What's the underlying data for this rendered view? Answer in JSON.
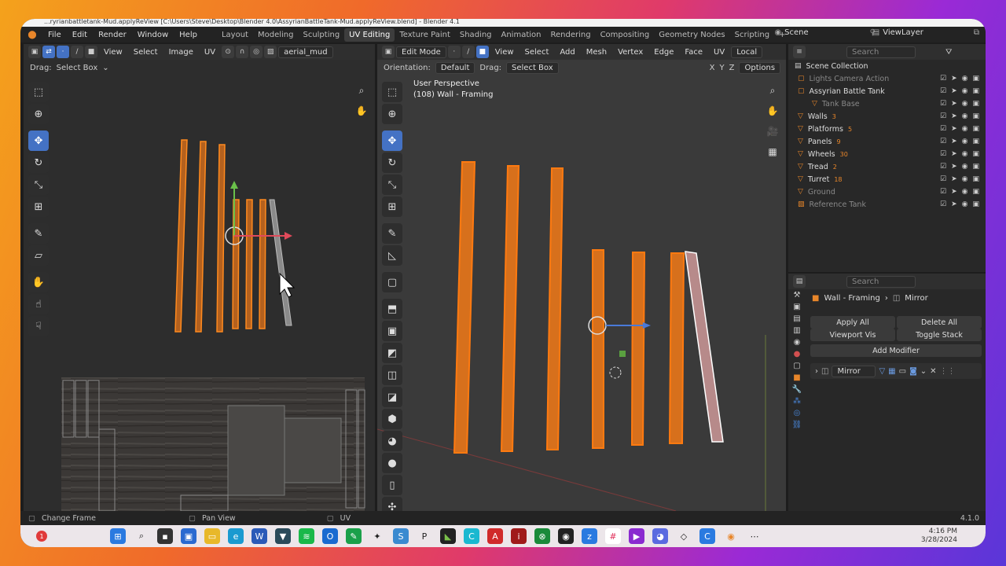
{
  "titlebar": {
    "text": "...ryrianbattletank-Mud.applyReView [C:\\Users\\Steve\\Desktop\\Blender 4.0\\AssyrianBattleTank-Mud.applyReView.blend] - Blender 4.1"
  },
  "menu": [
    "File",
    "Edit",
    "Render",
    "Window",
    "Help"
  ],
  "workspaces": [
    "Layout",
    "Modeling",
    "Sculpting",
    "UV Editing",
    "Texture Paint",
    "Shading",
    "Animation",
    "Rendering",
    "Compositing",
    "Geometry Nodes",
    "Scripting"
  ],
  "active_workspace": "UV Editing",
  "scene": {
    "label": "Scene",
    "view_layer": "ViewLayer"
  },
  "uv_editor": {
    "header": [
      "View",
      "Select",
      "Image",
      "UV"
    ],
    "image_name": "aerial_mud",
    "drag_label": "Drag:",
    "drag_value": "Select Box"
  },
  "viewport": {
    "mode": "Edit Mode",
    "header": [
      "View",
      "Select",
      "Add",
      "Mesh",
      "Vertex",
      "Edge",
      "Face",
      "UV"
    ],
    "transform": "Local",
    "orientation_label": "Orientation:",
    "orientation_value": "Default",
    "drag_label": "Drag:",
    "drag_value": "Select Box",
    "axes": [
      "X",
      "Y",
      "Z"
    ],
    "options": "Options",
    "overlay_line1": "User Perspective",
    "overlay_line2": "(108) Wall - Framing"
  },
  "outliner": {
    "search_placeholder": "Search",
    "title": "Scene Collection",
    "items": [
      {
        "name": "Lights Camera Action",
        "badge": "",
        "dim": true
      },
      {
        "name": "Assyrian Battle Tank",
        "badge": "",
        "dim": false
      },
      {
        "name": "Tank Base",
        "badge": "",
        "dim": true
      },
      {
        "name": "Walls",
        "badge": "3",
        "dim": false
      },
      {
        "name": "Platforms",
        "badge": "5",
        "dim": false
      },
      {
        "name": "Panels",
        "badge": "9",
        "dim": false
      },
      {
        "name": "Wheels",
        "badge": "30",
        "dim": false
      },
      {
        "name": "Tread",
        "badge": "2",
        "dim": false
      },
      {
        "name": "Turret",
        "badge": "18",
        "dim": false
      },
      {
        "name": "Ground",
        "badge": "",
        "dim": true
      },
      {
        "name": "Reference Tank",
        "badge": "",
        "dim": true
      }
    ]
  },
  "properties": {
    "search_placeholder": "Search",
    "breadcrumb_object": "Wall - Framing",
    "breadcrumb_modifier": "Mirror",
    "apply_all": "Apply All",
    "delete_all": "Delete All",
    "viewport_vis": "Viewport Vis",
    "toggle_stack": "Toggle Stack",
    "add_modifier": "Add Modifier",
    "modifier_name": "Mirror"
  },
  "statusbar": {
    "left": "Change Frame",
    "mid": "Pan View",
    "right": "UV",
    "version": "4.1.0"
  },
  "taskbar": {
    "time": "4:16 PM",
    "date": "3/28/2024"
  },
  "colors": {
    "accent": "#4472c4",
    "selected": "#ff8a1e",
    "background": "#2b2b2b"
  }
}
